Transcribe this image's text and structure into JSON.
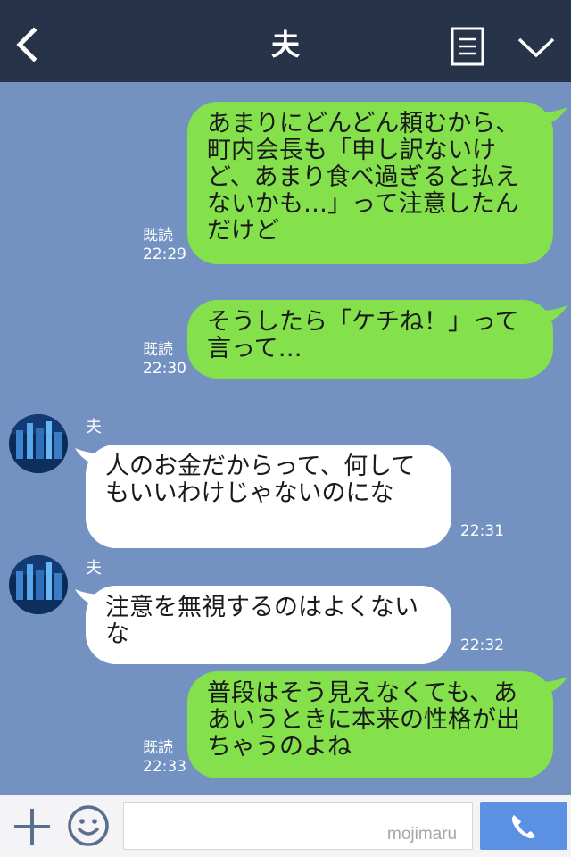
{
  "header": {
    "title": "夫",
    "back_icon": "chevron-left-icon",
    "notes_icon": "notes-icon",
    "menu_icon": "chevron-down-icon"
  },
  "colors": {
    "header_bg": "#263348",
    "chat_bg": "#7392c2",
    "outgoing_bubble": "#84e04b",
    "incoming_bubble": "#ffffff",
    "call_button": "#5b90e3"
  },
  "messages": [
    {
      "direction": "out",
      "text": "あまりにどんどん頼むから、町内会長も「申し訳ないけど、あまり食べ過ぎると払えないかも…」って注意したんだけど",
      "read": "既読",
      "time": "22:29"
    },
    {
      "direction": "out",
      "text": "そうしたら「ケチね！」って言って…",
      "read": "既読",
      "time": "22:30"
    },
    {
      "direction": "in",
      "sender": "夫",
      "text": "人のお金だからって、何してもいいわけじゃないのにな",
      "time": "22:31"
    },
    {
      "direction": "in",
      "sender": "夫",
      "text": "注意を無視するのはよくないな",
      "time": "22:32"
    },
    {
      "direction": "out",
      "text": "普段はそう見えなくても、ああいうときに本来の性格が出ちゃうのよね",
      "read": "既読",
      "time": "22:33"
    }
  ],
  "input_bar": {
    "plus_icon": "plus-icon",
    "emoji_icon": "smiley-icon",
    "input_value": "",
    "call_icon": "phone-icon",
    "watermark": "mojimaru"
  }
}
